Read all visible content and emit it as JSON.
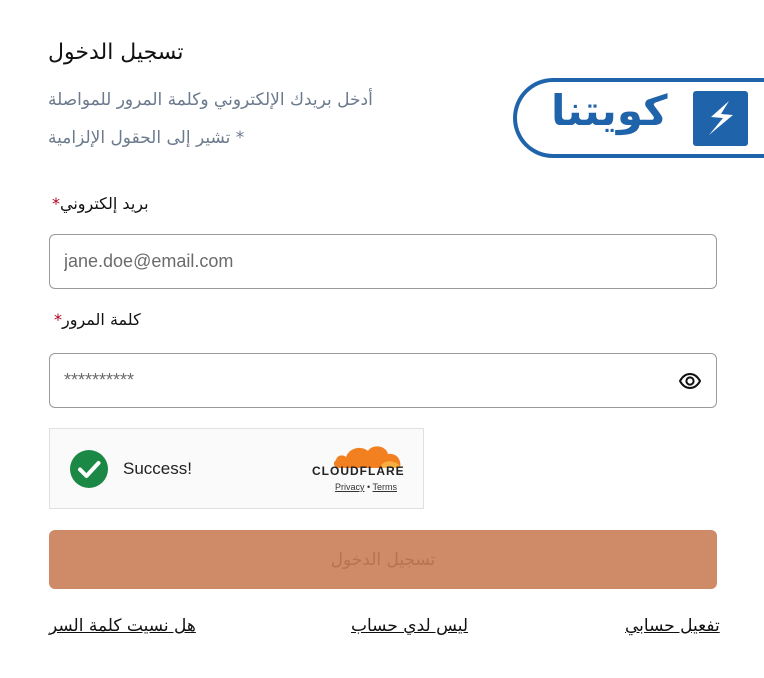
{
  "header": {
    "title": "تسجيل الدخول",
    "subtitle": "أدخل بريدك الإلكتروني وكلمة المرور للمواصلة",
    "required_note": "* تشير إلى الحقول الإلزامية"
  },
  "logo": {
    "text": "كويتنا",
    "brand_color": "#1f64ab"
  },
  "form": {
    "email": {
      "label": "بريد إلكتروني",
      "required_mark": "*",
      "placeholder": "jane.doe@email.com"
    },
    "password": {
      "label": "كلمة المرور",
      "required_mark": "*",
      "placeholder": "**********"
    },
    "captcha": {
      "status": "Success!",
      "provider": "CLOUDFLARE",
      "privacy": "Privacy",
      "separator": "•",
      "terms": "Terms"
    },
    "submit_label": "تسجيل الدخول",
    "submit_color": "#cf8a68"
  },
  "links": {
    "forgot_password": "هل نسيت كلمة السر",
    "no_account": "ليس لدي حساب",
    "activate": "تفعيل حسابي"
  }
}
